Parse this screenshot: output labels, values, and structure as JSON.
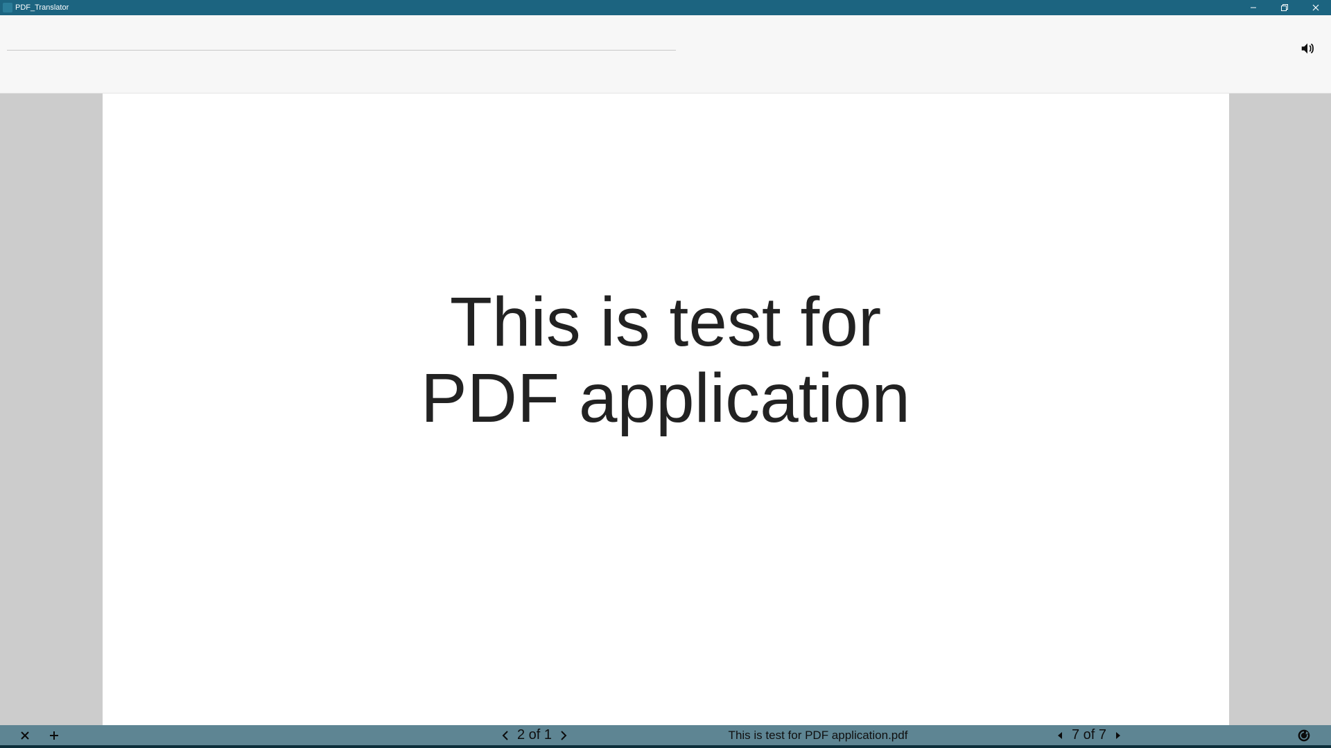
{
  "window": {
    "title": "PDF_Translator"
  },
  "document": {
    "content": "This is test for PDF application"
  },
  "statusbar": {
    "filename": "This is test for PDF application.pdf",
    "pager_left": "2 of 1",
    "pager_right": "7 of 7"
  }
}
